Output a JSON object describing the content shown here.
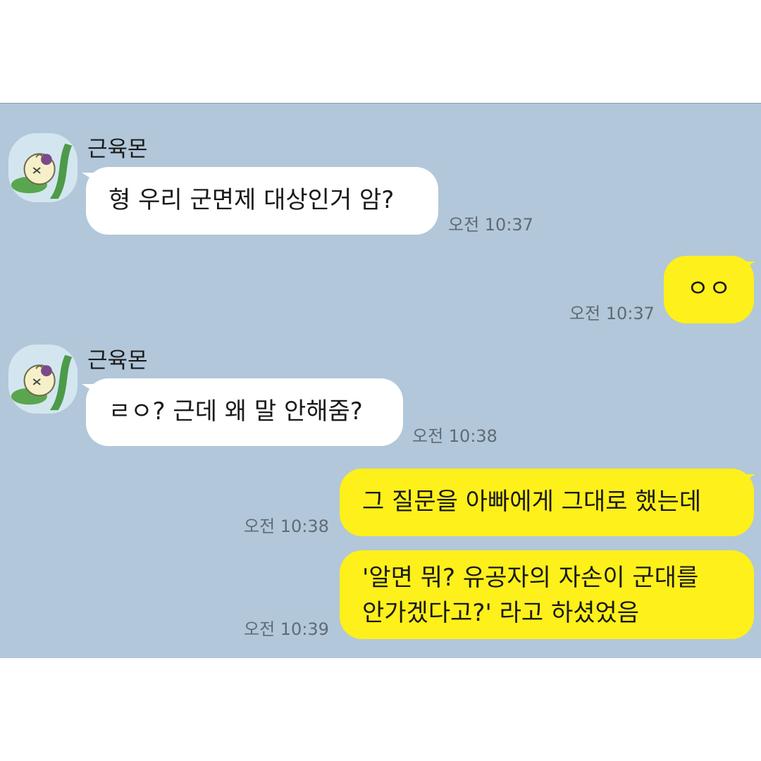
{
  "messages": [
    {
      "sender": "근육몬",
      "text": "형 우리 군면제 대상인거 암?",
      "time": "오전 10:37"
    },
    {
      "text": "ㅇㅇ",
      "time": "오전 10:37"
    },
    {
      "sender": "근육몬",
      "text": "ㄹㅇ? 근데 왜 말 안해줌?",
      "time": "오전 10:38"
    },
    {
      "text": "그 질문을 아빠에게 그대로 했는데",
      "time": "오전 10:38"
    },
    {
      "text_line1": "'알면 뭐? 유공자의 자손이 군대를",
      "text_line2": "안가겠다고?' 라고 하셨었음",
      "time": "오전 10:39"
    }
  ],
  "colors": {
    "chat_background": "#b2c7d9",
    "incoming_bubble": "#ffffff",
    "outgoing_bubble": "#fef01b"
  },
  "icons": {
    "avatar": "cartoon-character-avatar-icon"
  }
}
